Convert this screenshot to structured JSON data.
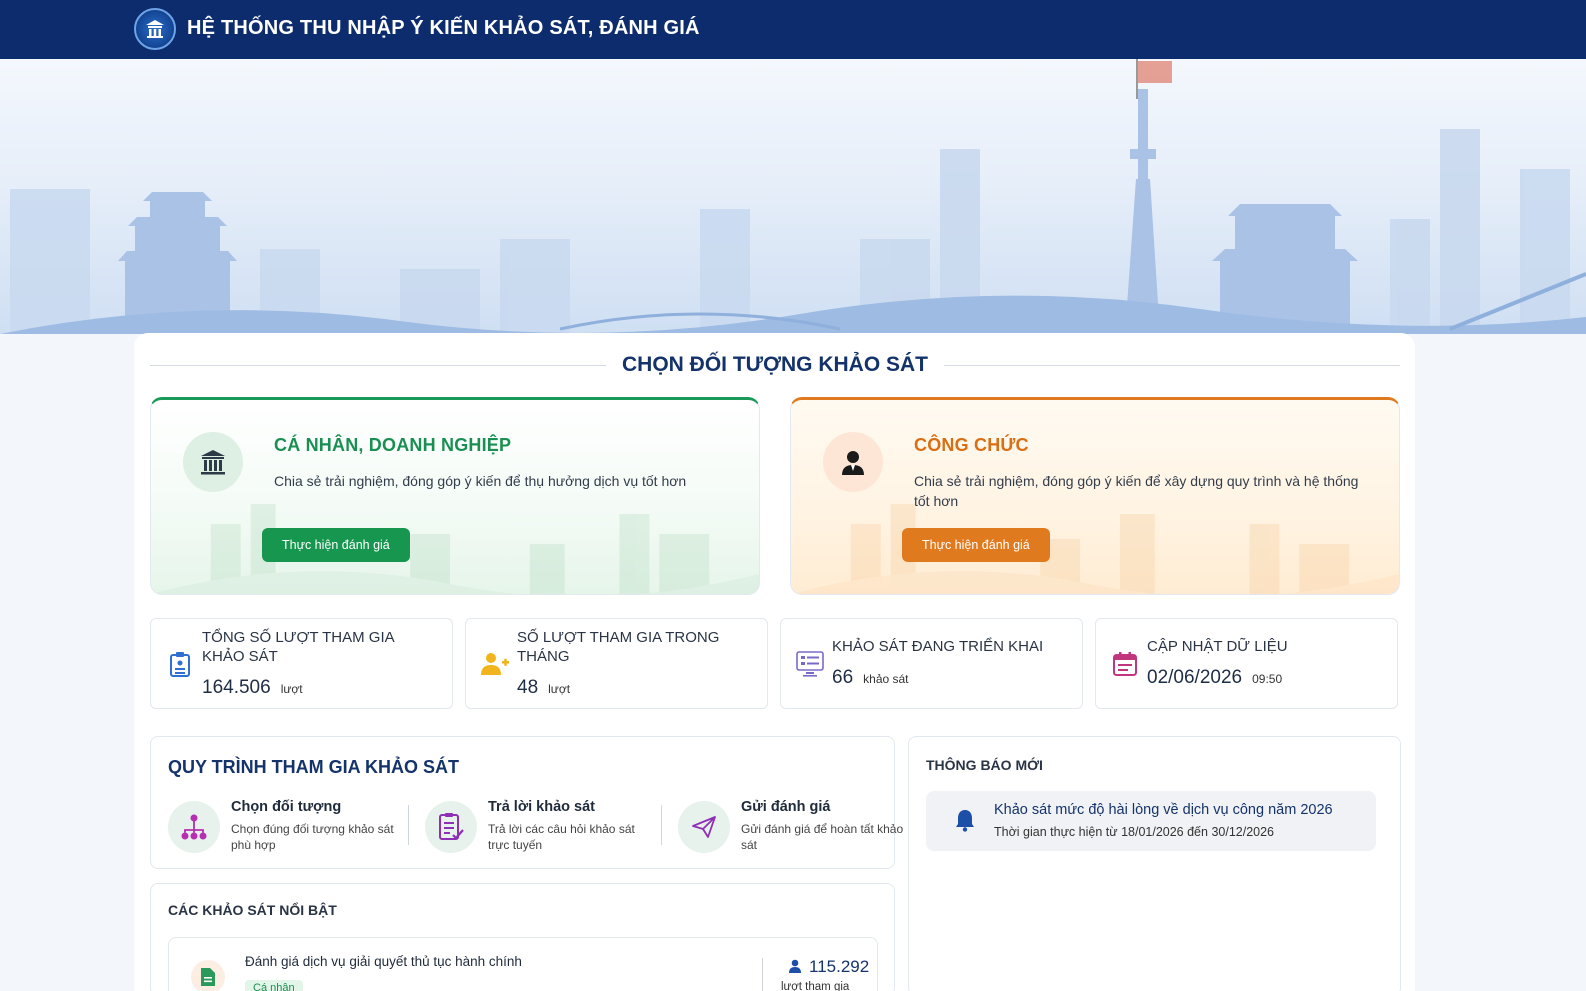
{
  "header": {
    "title": "HỆ THỐNG THU NHẬP Ý KIẾN KHẢO SÁT, ĐÁNH GIÁ"
  },
  "section": {
    "title": "CHỌN ĐỐI TƯỢNG KHẢO SÁT"
  },
  "targets": [
    {
      "title": "CÁ NHÂN, DOANH NGHIỆP",
      "description": "Chia sẻ trải nghiệm, đóng góp ý kiến để thụ hưởng dịch vụ tốt hơn",
      "button": "Thực hiện đánh giá",
      "icon": "building-icon",
      "color": "#16964f"
    },
    {
      "title": "CÔNG CHỨC",
      "description": "Chia sẻ trải nghiệm, đóng góp ý kiến để xây dựng quy trình và hệ thống tốt hơn",
      "button": "Thực hiện đánh giá",
      "icon": "person-icon",
      "color": "#e07a1f"
    }
  ],
  "stats": [
    {
      "label": "TỔNG SỐ LƯỢT THAM GIA KHẢO SÁT",
      "value": "164.506",
      "unit": "lượt",
      "icon": "clipboard-icon",
      "color": "#2f6fd3"
    },
    {
      "label": "SỐ LƯỢT THAM GIA TRONG THÁNG",
      "value": "48",
      "unit": "lượt",
      "icon": "add-user-icon",
      "color": "#f2b41c"
    },
    {
      "label": "KHẢO SÁT ĐANG TRIỂN KHAI",
      "value": "66",
      "unit": "khảo sát",
      "icon": "monitor-list-icon",
      "color": "#7a6ac8"
    },
    {
      "label": "CẬP NHẬT DỮ LIỆU",
      "value": "02/06/2026",
      "unit": "09:50",
      "icon": "calendar-icon",
      "color": "#c2367f"
    }
  ],
  "process": {
    "title": "QUY TRÌNH THAM GIA KHẢO SÁT",
    "steps": [
      {
        "name": "Chọn đối tượng",
        "desc": "Chọn đúng đối tượng khảo sát phù hợp",
        "icon": "hierarchy-icon"
      },
      {
        "name": "Trả lời khảo sát",
        "desc": "Trả lời các câu hỏi khảo sát trực tuyến",
        "icon": "checklist-icon"
      },
      {
        "name": "Gửi đánh giá",
        "desc": "Gửi đánh giá để hoàn tất khảo sát",
        "icon": "send-icon"
      }
    ]
  },
  "notices": {
    "title": "THÔNG BÁO MỚI",
    "items": [
      {
        "title": "Khảo sát mức độ hài lòng về dịch vụ công năm 2026",
        "sub": "Thời gian thực hiện từ 18/01/2026 đến 30/12/2026",
        "icon": "bell-icon"
      }
    ]
  },
  "featured": {
    "title": "CÁC KHẢO SÁT NỔI BẬT",
    "items": [
      {
        "name": "Đánh giá dịch vụ giải quyết thủ tục hành chính",
        "badge": "Cá nhân",
        "count": "115.292",
        "count_label": "lượt tham gia",
        "icon": "document-icon"
      }
    ]
  }
}
